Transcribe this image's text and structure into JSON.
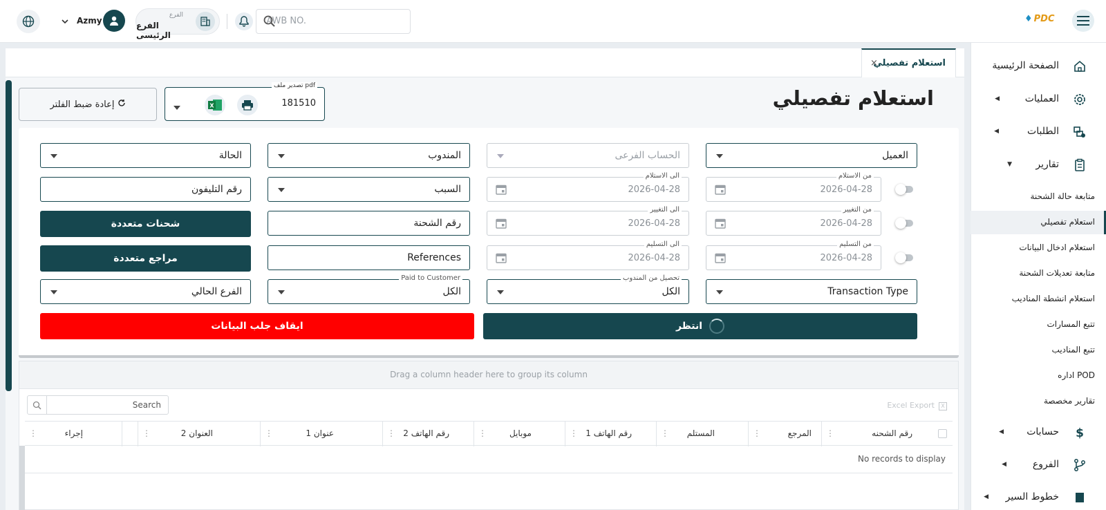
{
  "header": {
    "logo_text": "PDC",
    "awb_placeholder": "AWB NO.",
    "branch_label": "الفرع",
    "branch_value": "الفرع الرئيسى",
    "user_name": "Azmy"
  },
  "sidebar": {
    "items": [
      {
        "label": "الصفحة الرئيسية",
        "icon": "home-icon"
      },
      {
        "label": "العمليات",
        "icon": "operations-icon"
      },
      {
        "label": "الطلبات",
        "icon": "orders-icon"
      },
      {
        "label": "تقارير",
        "icon": "reports-icon"
      },
      {
        "label": "حسابات",
        "icon": "dollar-icon"
      },
      {
        "label": "الفروع",
        "icon": "branch-icon"
      },
      {
        "label": "خطوط السير",
        "icon": "routes-icon"
      }
    ],
    "sub_items": [
      {
        "label": "متابعة حالة الشحنة"
      },
      {
        "label": "استعلام تفصيلي"
      },
      {
        "label": "استعلام ادخال البيانات"
      },
      {
        "label": "متابعة تعديلات الشحنة"
      },
      {
        "label": "استعلام انشطة المناديب"
      },
      {
        "label": "تتبع المسارات"
      },
      {
        "label": "تتبع المناديب"
      },
      {
        "label": "اداره POD"
      },
      {
        "label": "تقارير مخصصة"
      }
    ]
  },
  "tab": {
    "label": "استعلام تفصيلي",
    "close": "×"
  },
  "page": {
    "title": "استعلام تفصيلي",
    "export_legend": "تصدير ملف pdf",
    "export_value": "181510",
    "reset_label": "إعادة ضبط الفلتر"
  },
  "filters": {
    "customer": "العميل",
    "sub_account": "الحساب الفرعى",
    "courier": "المندوب",
    "status": "الحالة",
    "from_receive_legend": "من الاستلام",
    "to_receive_legend": "الى الاستلام",
    "from_change_legend": "من التغيير",
    "to_change_legend": "الى التغيير",
    "from_deliver_legend": "من التسليم",
    "to_deliver_legend": "الى التسليم",
    "date_value": "2026-04-28",
    "reason": "السبب",
    "phone": "رقم التليفون",
    "shipment_no": "رقم الشحنة",
    "multi_shipments": "شحنات متعددة",
    "references": "References",
    "multi_refs": "مراجع متعددة",
    "transaction_type": "Transaction Type",
    "collect_legend": "تحصيل من المندوب",
    "collect_value": "الكل",
    "paid_legend": "Paid to Customer",
    "paid_value": "الكل",
    "current_branch": "الفرع الحالي",
    "wait_button": "انتظر",
    "stop_button": "ايقاف جلب البيانات"
  },
  "grid": {
    "group_hint": "Drag a column header here to group its column",
    "search_placeholder": "Search",
    "excel_export": "Excel Export",
    "columns": [
      "رقم الشحنه",
      "المرجع",
      "المستلم",
      "رقم الهاتف 1",
      "موبايل",
      "رقم الهاتف 2",
      "1 عنوان",
      "العنوان 2",
      "",
      "إجراء"
    ],
    "empty_text": "No records to display"
  },
  "colors": {
    "primary": "#16474f",
    "danger": "#ff0000",
    "logo_orange": "#e39a17"
  }
}
